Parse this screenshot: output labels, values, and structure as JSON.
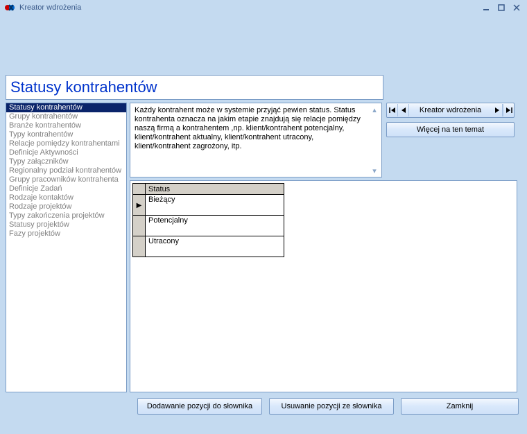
{
  "window": {
    "title": "Kreator wdrożenia"
  },
  "heading": "Statusy kontrahentów",
  "sidebar": {
    "items": [
      "Statusy kontrahentów",
      "Grupy kontrahentów",
      "Branże kontrahentów",
      "Typy kontrahentów",
      "Relacje pomiędzy kontrahentami",
      "Definicje Aktywności",
      "Typy załączników",
      "Regionalny podział kontrahentów",
      "Grupy pracowników kontrahenta",
      "Definicje Zadań",
      "Rodzaje kontaktów",
      "Rodzaje projektów",
      "Typy zakończenia projektów",
      "Statusy projektów",
      "Fazy projektów"
    ],
    "selected_index": 0
  },
  "description": "Każdy kontrahent może w systemie przyjąć pewien status.  Status kontrahenta oznacza  na jakim etapie znajdują się relacje pomiędzy naszą firmą a kontrahentem ,np. klient/kontrahent  potencjalny, klient/kontrahent aktualny, klient/kontrahent utracony, klient/kontrahent zagrożony, itp.",
  "grid": {
    "header": "Status",
    "rows": [
      "Bieżący",
      "Potencjalny",
      "Utracony"
    ],
    "current_row": 0
  },
  "nav": {
    "label": "Kreator wdrożenia"
  },
  "buttons": {
    "more": "Więcej na ten temat",
    "add": "Dodawanie pozycji do słownika",
    "remove": "Usuwanie pozycji ze słownika",
    "close": "Zamknij"
  }
}
